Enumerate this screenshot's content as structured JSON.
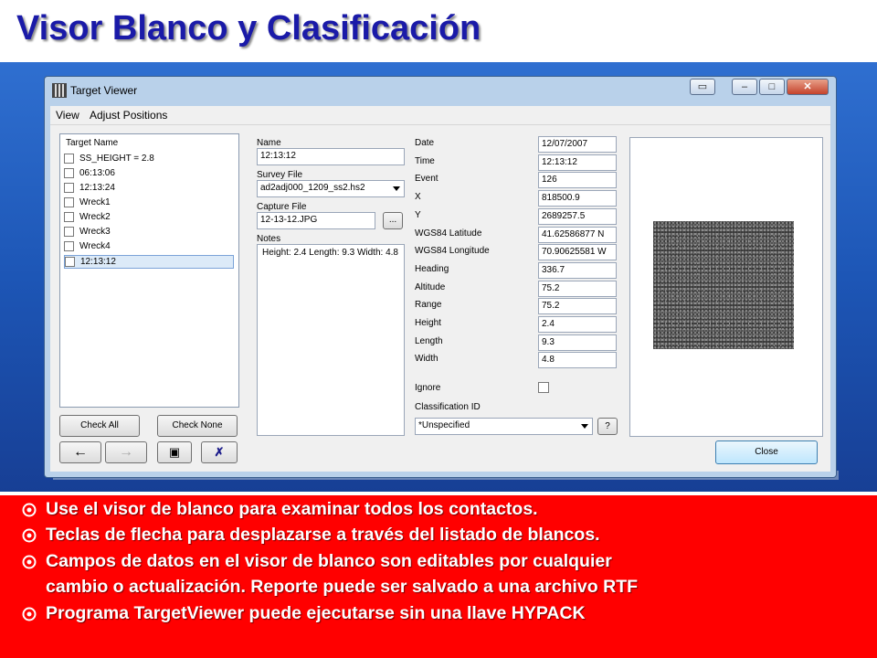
{
  "slide": {
    "title": "Visor Blanco y Clasificación"
  },
  "window": {
    "title": "Target Viewer",
    "menu": [
      "View",
      "Adjust Positions"
    ]
  },
  "target_list": {
    "header": "Target Name",
    "items": [
      "SS_HEIGHT = 2.8",
      "06:13:06",
      "12:13:24",
      "Wreck1",
      "Wreck2",
      "Wreck3",
      "Wreck4",
      "12:13:12"
    ],
    "selected_index": 7
  },
  "buttons": {
    "check_all": "Check All",
    "check_none": "Check None",
    "prev_icon": "left-arrow-icon",
    "next_icon": "right-arrow-icon",
    "save_icon": "save-icon",
    "delete_icon": "delete-icon",
    "browse": "...",
    "help": "?",
    "close": "Close"
  },
  "form": {
    "name_label": "Name",
    "name_value": "12:13:12",
    "survey_label": "Survey File",
    "survey_value": "ad2adj000_1209_ss2.hs2",
    "capture_label": "Capture File",
    "capture_value": "12-13-12.JPG",
    "notes_label": "Notes",
    "notes_value": "Height: 2.4 Length: 9.3 Width: 4.8"
  },
  "details": [
    {
      "label": "Date",
      "value": "12/07/2007"
    },
    {
      "label": "Time",
      "value": "12:13:12"
    },
    {
      "label": "Event",
      "value": "126"
    },
    {
      "label": "X",
      "value": "818500.9"
    },
    {
      "label": "Y",
      "value": "2689257.5"
    },
    {
      "label": "WGS84 Latitude",
      "value": "41.62586877 N"
    },
    {
      "label": "WGS84 Longitude",
      "value": "70.90625581 W"
    },
    {
      "label": "Heading",
      "value": "336.7"
    },
    {
      "label": "Altitude",
      "value": "75.2"
    },
    {
      "label": "Range",
      "value": "75.2"
    },
    {
      "label": "Height",
      "value": "2.4"
    },
    {
      "label": "Length",
      "value": "9.3"
    },
    {
      "label": "Width",
      "value": "4.8"
    }
  ],
  "ignore": {
    "label": "Ignore",
    "checked": false
  },
  "classification": {
    "label": "Classification ID",
    "value": "*Unspecified"
  },
  "bullets": [
    "Use el visor de blanco para examinar todos los contactos.",
    "Teclas de flecha para desplazarse a través del listado de blancos.",
    "Campos de datos en el visor de blanco son editables por cualquier",
    "cambio o actualización. Reporte puede ser salvado a una archivo RTF",
    "Programa TargetViewer puede ejecutarse sin una llave HYPACK"
  ],
  "colors": {
    "title": "#1a1aa8",
    "bullet_background": "#ff0000",
    "desktop": "#1d56b6",
    "window_frame": "#b9d1ea"
  }
}
